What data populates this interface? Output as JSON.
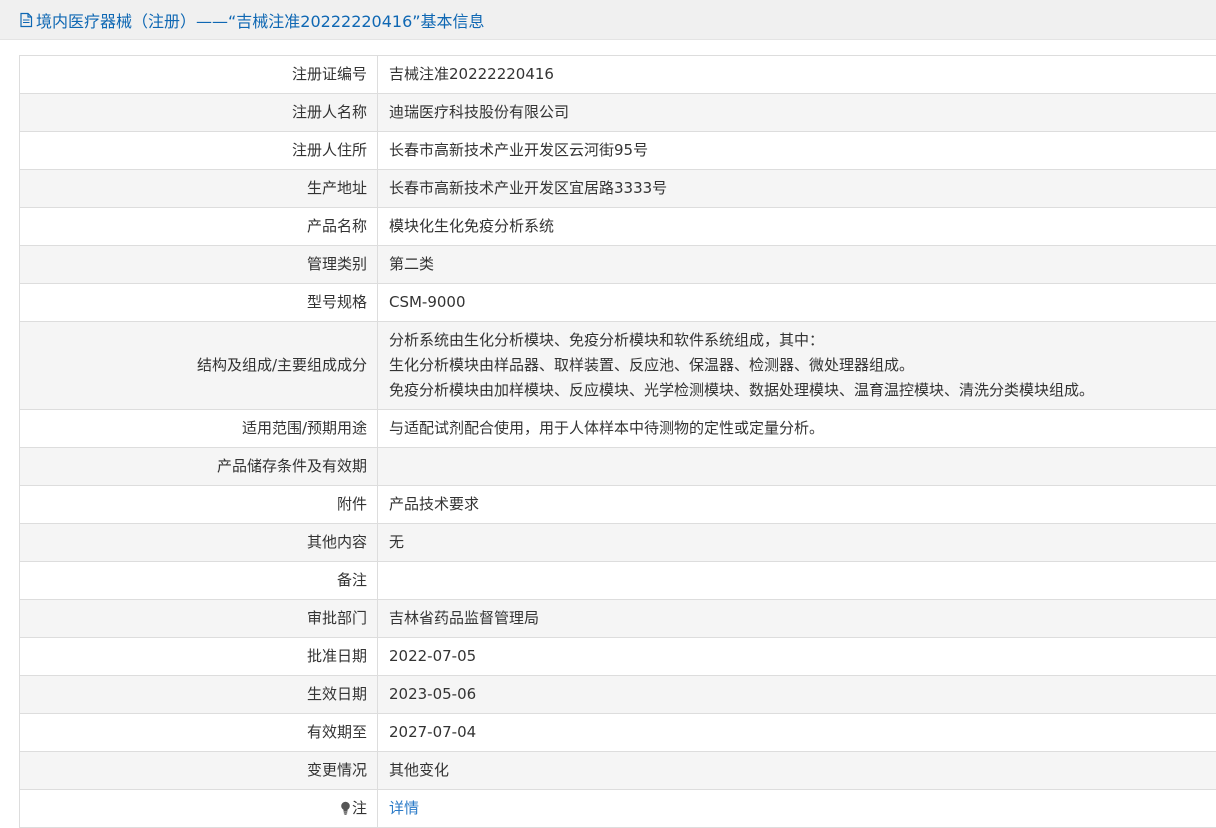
{
  "header": {
    "title": "境内医疗器械（注册）——“吉械注准20222220416”基本信息",
    "icon": "document-icon"
  },
  "rows": [
    {
      "label": "注册证编号",
      "value": "吉械注准20222220416"
    },
    {
      "label": "注册人名称",
      "value": "迪瑞医疗科技股份有限公司"
    },
    {
      "label": "注册人住所",
      "value": "长春市高新技术产业开发区云河街95号"
    },
    {
      "label": "生产地址",
      "value": "长春市高新技术产业开发区宜居路3333号"
    },
    {
      "label": "产品名称",
      "value": "模块化生化免疫分析系统"
    },
    {
      "label": "管理类别",
      "value": "第二类"
    },
    {
      "label": "型号规格",
      "value": "CSM-9000"
    },
    {
      "label": "结构及组成/主要组成成分",
      "lines": [
        "分析系统由生化分析模块、免疫分析模块和软件系统组成，其中：",
        "生化分析模块由样品器、取样装置、反应池、保温器、检测器、微处理器组成。",
        "免疫分析模块由加样模块、反应模块、光学检测模块、数据处理模块、温育温控模块、清洗分类模块组成。"
      ]
    },
    {
      "label": "适用范围/预期用途",
      "value": "与适配试剂配合使用，用于人体样本中待测物的定性或定量分析。"
    },
    {
      "label": "产品储存条件及有效期",
      "value": ""
    },
    {
      "label": "附件",
      "value": "产品技术要求"
    },
    {
      "label": "其他内容",
      "value": "无"
    },
    {
      "label": "备注",
      "value": ""
    },
    {
      "label": "审批部门",
      "value": "吉林省药品监督管理局"
    },
    {
      "label": "批准日期",
      "value": "2022-07-05"
    },
    {
      "label": "生效日期",
      "value": "2023-05-06"
    },
    {
      "label": "有效期至",
      "value": "2027-07-04"
    },
    {
      "label": "变更情况",
      "value": "其他变化"
    },
    {
      "label": "注",
      "value": "详情",
      "label_icon": "lightbulb-icon"
    }
  ],
  "colors": {
    "header_text": "#0e67b3",
    "header_bg": "#f0f0f0",
    "link": "#2a7ac7",
    "border": "#dddddd",
    "stripe": "#f5f5f5"
  }
}
